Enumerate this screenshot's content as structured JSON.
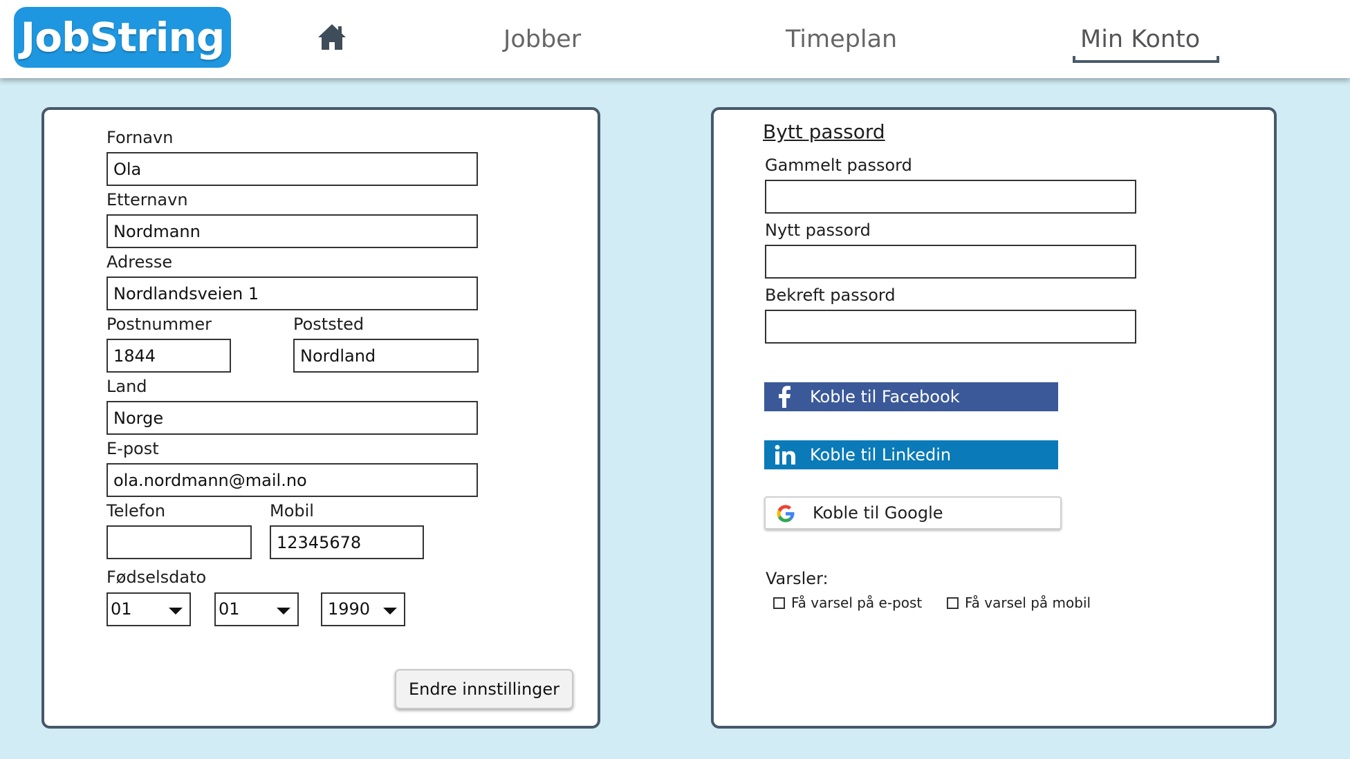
{
  "app": {
    "logo": "JobString"
  },
  "nav": {
    "home_icon": "home-icon",
    "items": [
      "Jobber",
      "Timeplan",
      "Min Konto"
    ],
    "active": "Min Konto"
  },
  "profile": {
    "fornavn_label": "Fornavn",
    "fornavn_value": "Ola",
    "etternavn_label": "Etternavn",
    "etternavn_value": "Nordmann",
    "adresse_label": "Adresse",
    "adresse_value": "Nordlandsveien 1",
    "postnummer_label": "Postnummer",
    "postnummer_value": "1844",
    "poststed_label": "Poststed",
    "poststed_value": "Nordland",
    "land_label": "Land",
    "land_value": "Norge",
    "epost_label": "E-post",
    "epost_value": "ola.nordmann@mail.no",
    "telefon_label": "Telefon",
    "telefon_value": "",
    "mobil_label": "Mobil",
    "mobil_value": "12345678",
    "fodselsdato_label": "Fødselsdato",
    "fodselsdato_day": "01",
    "fodselsdato_month": "01",
    "fodselsdato_year": "1990",
    "save_button": "Endre innstillinger"
  },
  "password": {
    "title": "Bytt passord",
    "old_label": "Gammelt passord",
    "old_value": "",
    "new_label": "Nytt passord",
    "new_value": "",
    "confirm_label": "Bekreft passord",
    "confirm_value": ""
  },
  "social": {
    "facebook": "Koble til Facebook",
    "linkedin": "Koble til Linkedin",
    "google": "Koble til Google",
    "colors": {
      "facebook": "#3b5998",
      "linkedin": "#0a7ab8"
    }
  },
  "notifications": {
    "label": "Varsler:",
    "email": "Få varsel på e-post",
    "mobile": "Få varsel på mobil",
    "email_checked": false,
    "mobile_checked": false
  },
  "colors": {
    "background": "#d1ecf4",
    "logo": "#1e97e0",
    "card_border": "#47586a"
  }
}
